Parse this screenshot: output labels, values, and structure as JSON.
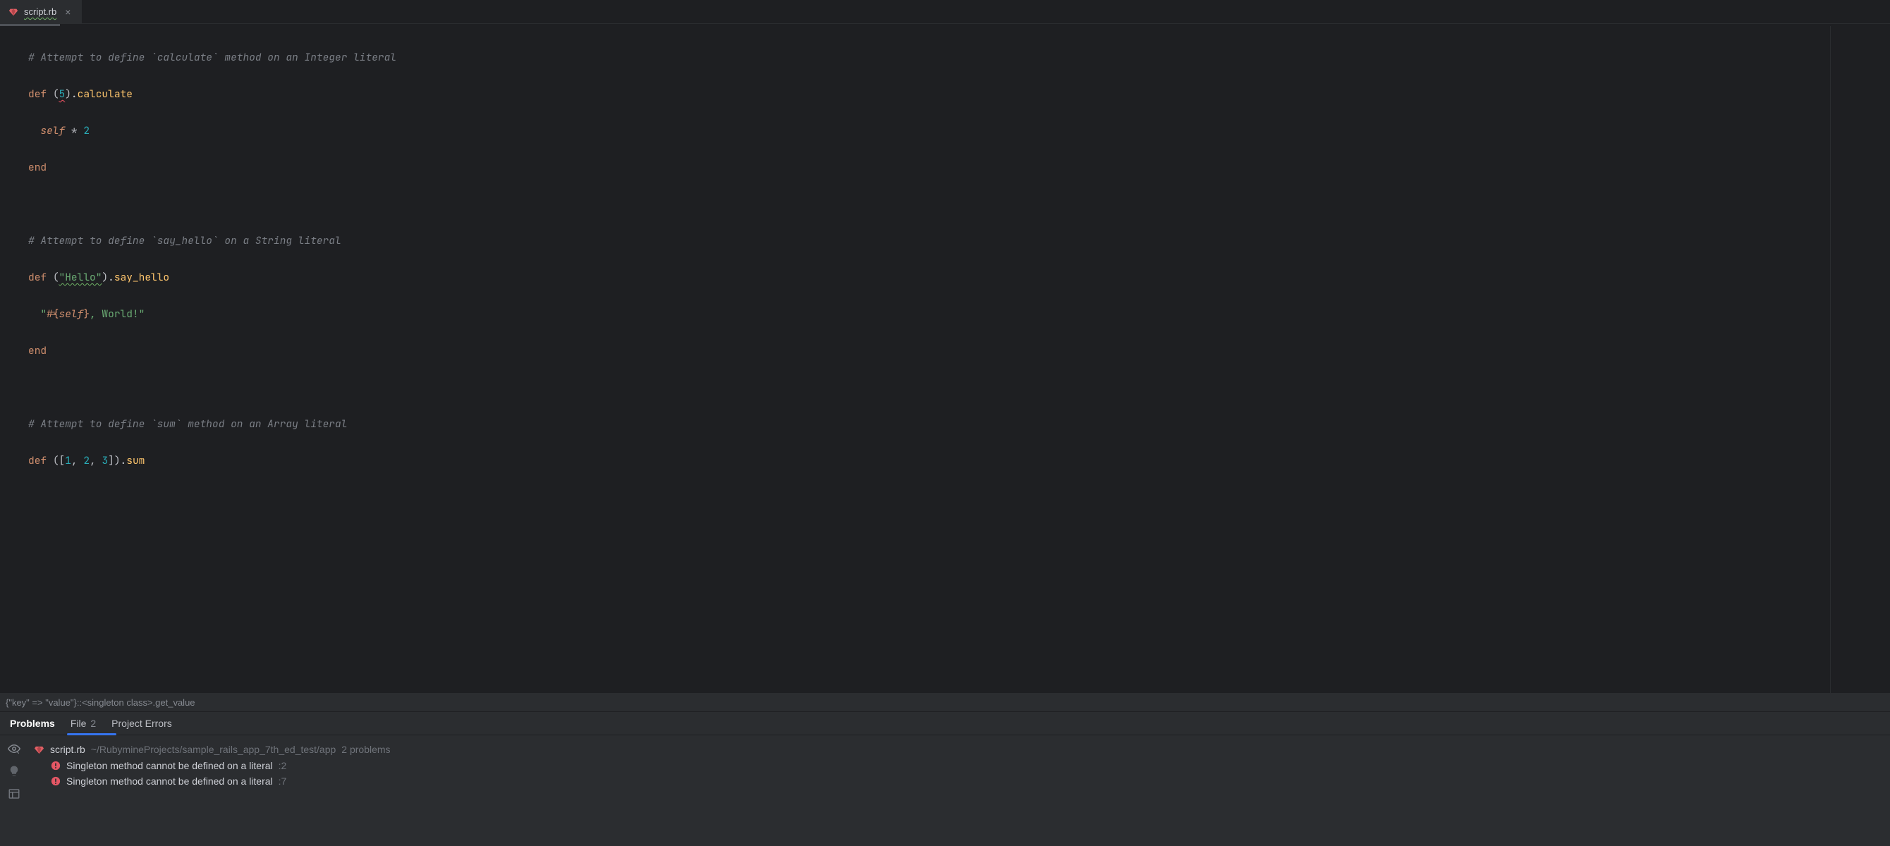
{
  "tab": {
    "filename": "script.rb"
  },
  "code": {
    "l1": "# Attempt to define `calculate` method on an Integer literal",
    "l2_def": "def",
    "l2_paren1": "(",
    "l2_num": "5",
    "l2_paren2": ")",
    "l2_dot": ".",
    "l2_name": "calculate",
    "l3_self": "self",
    "l3_op": " * ",
    "l3_num": "2",
    "l4_end": "end",
    "l6": "# Attempt to define `say_hello` on a String literal",
    "l7_def": "def",
    "l7_paren1": "(",
    "l7_str": "\"Hello\"",
    "l7_paren2": ")",
    "l7_dot": ".",
    "l7_name": "say_hello",
    "l8_q1": "\"",
    "l8_int1": "#{",
    "l8_self": "self",
    "l8_int2": "}",
    "l8_rest": ", World!",
    "l8_q2": "\"",
    "l9_end": "end",
    "l11": "# Attempt to define `sum` method on an Array literal",
    "l12_def": "def",
    "l12_paren1": "(",
    "l12_br1": "[",
    "l12_n1": "1",
    "l12_c1": ", ",
    "l12_n2": "2",
    "l12_c2": ", ",
    "l12_n3": "3",
    "l12_br2": "]",
    "l12_paren2": ")",
    "l12_dot": ".",
    "l12_name": "sum"
  },
  "breadcrumb": {
    "text": "{\"key\" => \"value\"}::<singleton class>.get_value"
  },
  "problems": {
    "tabs": {
      "problems": "Problems",
      "file": "File",
      "file_count": "2",
      "project_errors": "Project Errors"
    },
    "file": {
      "name": "script.rb",
      "path": "~/RubymineProjects/sample_rails_app_7th_ed_test/app",
      "count": "2 problems"
    },
    "items": [
      {
        "msg": "Singleton method cannot be defined on a literal",
        "line": ":2"
      },
      {
        "msg": "Singleton method cannot be defined on a literal",
        "line": ":7"
      }
    ]
  }
}
